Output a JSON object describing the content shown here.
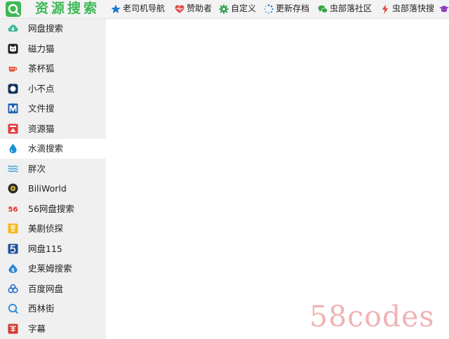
{
  "header": {
    "title": "资源搜索"
  },
  "nav": [
    {
      "label": "老司机导航",
      "icon": "star-icon"
    },
    {
      "label": "赞助者",
      "icon": "heart-icon"
    },
    {
      "label": "自定义",
      "icon": "gear-icon"
    },
    {
      "label": "更新存档",
      "icon": "loading-icon"
    },
    {
      "label": "虫部落社区",
      "icon": "chat-icon"
    },
    {
      "label": "虫部落快搜",
      "icon": "lightning-icon"
    }
  ],
  "sidebar": {
    "items": [
      {
        "label": "网盘搜索",
        "icon": "cloud-icon"
      },
      {
        "label": "磁力猫",
        "icon": "cat-icon"
      },
      {
        "label": "茶杯狐",
        "icon": "teacup-fox-icon"
      },
      {
        "label": "小不点",
        "icon": "dot-square-icon"
      },
      {
        "label": "文件搜",
        "icon": "file-search-icon"
      },
      {
        "label": "资源猫",
        "icon": "resource-cat-icon"
      },
      {
        "label": "水滴搜索",
        "icon": "water-drop-icon",
        "active": true
      },
      {
        "label": "胖次",
        "icon": "wave-icon"
      },
      {
        "label": "BiliWorld",
        "icon": "bili-icon"
      },
      {
        "label": "56网盘搜索",
        "icon": "56-logo-icon"
      },
      {
        "label": "美剧侦探",
        "icon": "mei-icon"
      },
      {
        "label": "网盘115",
        "icon": "115-icon"
      },
      {
        "label": "史莱姆搜索",
        "icon": "slime-icon"
      },
      {
        "label": "百度网盘",
        "icon": "baidu-pan-icon"
      },
      {
        "label": "西林街",
        "icon": "search-circle-icon"
      },
      {
        "label": "字幕",
        "icon": "subtitle-icon"
      }
    ]
  },
  "watermark": "58codes",
  "colors": {
    "brand": "#3cb955",
    "sidebar_bg": "#f0f0f0",
    "active_bg": "#ffffff"
  }
}
